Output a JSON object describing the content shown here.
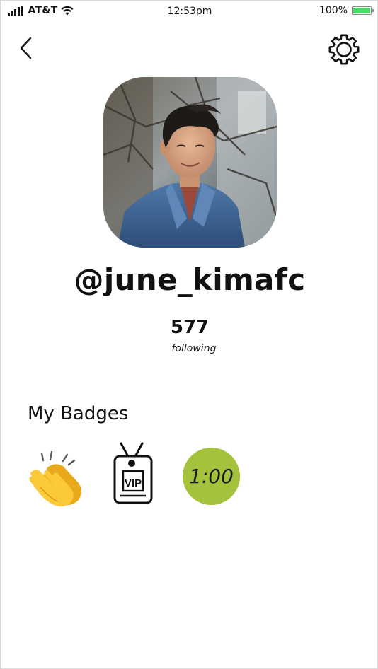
{
  "status_bar": {
    "carrier": "AT&T",
    "time": "12:53pm",
    "battery_percent": "100%",
    "battery_level": 1.0,
    "battery_color": "#4cd964",
    "signal_icon": "signal-bars-icon",
    "wifi_icon": "wifi-icon"
  },
  "nav": {
    "back_icon": "chevron-left-icon",
    "settings_icon": "gear-icon"
  },
  "profile": {
    "avatar_icon": "profile-photo",
    "username": "@june_kimafc",
    "following_count": "577",
    "following_label": "following"
  },
  "badges": {
    "heading": "My Badges",
    "items": [
      {
        "icon": "clapping-hands-icon"
      },
      {
        "icon": "vip-pass-icon",
        "label": "VIP"
      },
      {
        "icon": "timer-badge",
        "label": "1:00",
        "color": "#a4c23b"
      }
    ]
  },
  "colors": {
    "text": "#111111",
    "accent_green": "#a4c23b",
    "border": "#d7d7d7"
  }
}
